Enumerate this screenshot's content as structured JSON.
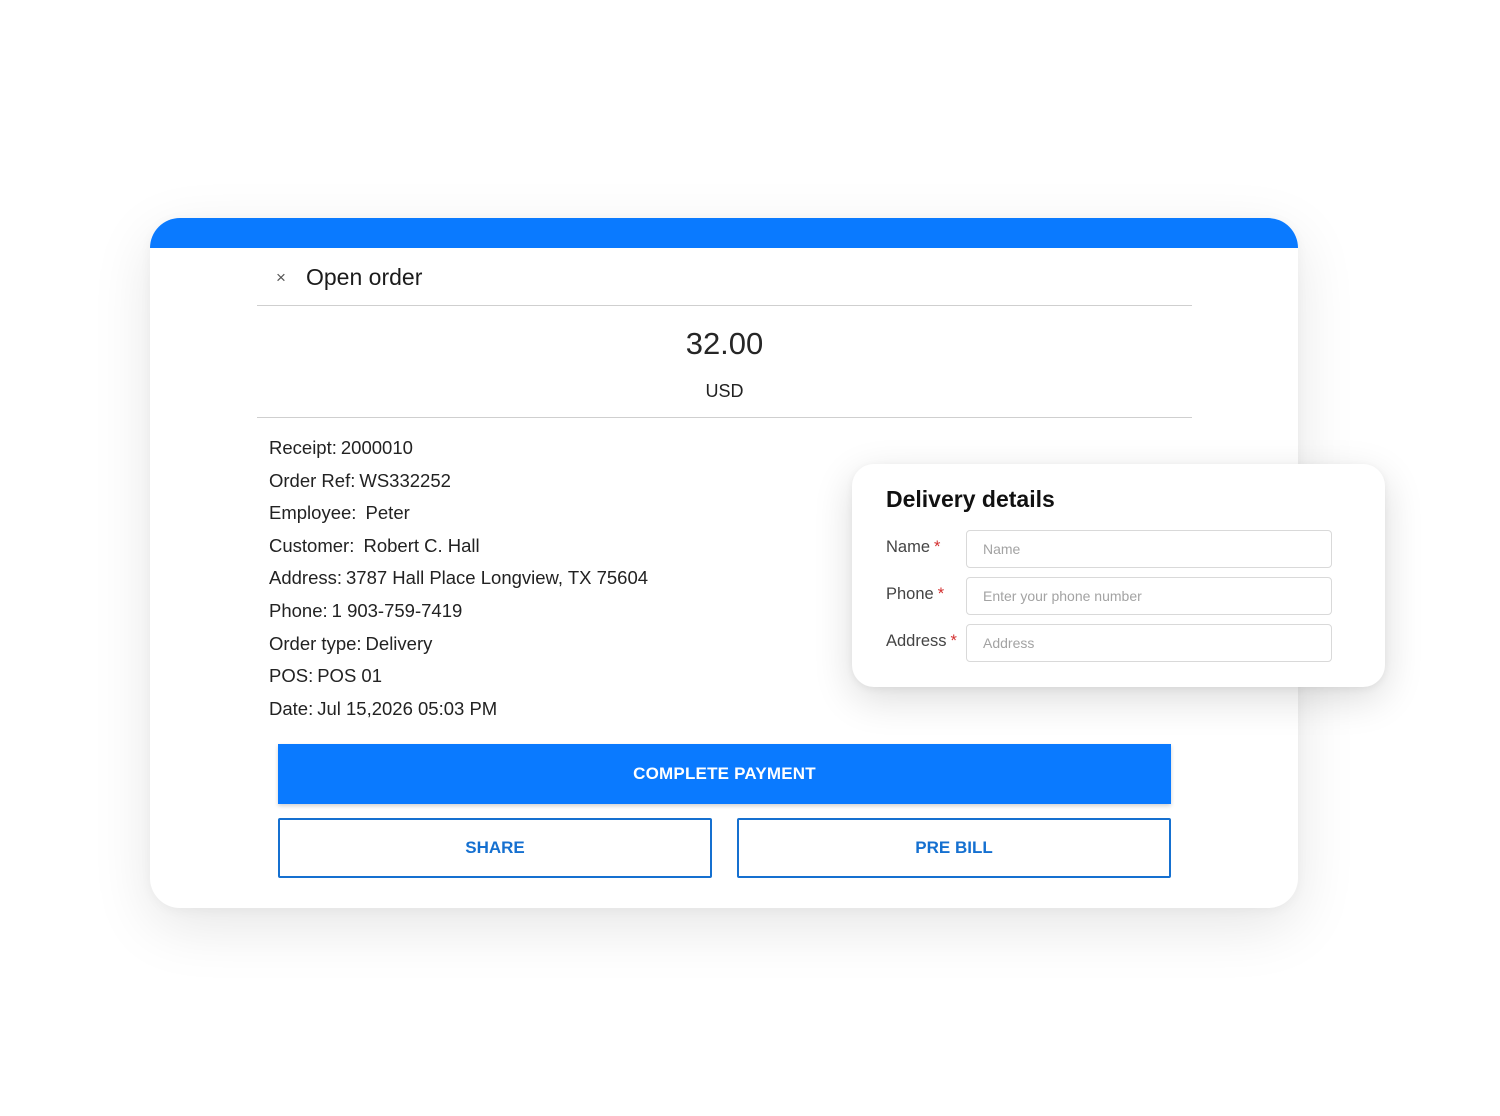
{
  "order": {
    "title": "Open order",
    "close_icon": "×",
    "amount": "32.00",
    "currency": "USD",
    "details": [
      {
        "label": "Receipt:",
        "value": "2000010"
      },
      {
        "label": "Order Ref:",
        "value": "WS332252"
      },
      {
        "label": "Employee:",
        "value": "Peter"
      },
      {
        "label": "Customer:",
        "value": "Robert C. Hall"
      },
      {
        "label": "Address:",
        "value": "3787 Hall Place Longview, TX 75604"
      },
      {
        "label": "Phone:",
        "value": "1 903-759-7419"
      },
      {
        "label": "Order type:",
        "value": "Delivery"
      },
      {
        "label": "POS:",
        "value": "POS 01"
      },
      {
        "label": "Date:",
        "value": "Jul 15,2026 05:03 PM"
      }
    ],
    "buttons": {
      "complete_payment": "COMPLETE PAYMENT",
      "share": "SHARE",
      "pre_bill": "PRE BILL"
    }
  },
  "delivery": {
    "title": "Delivery details",
    "required_mark": "*",
    "fields": {
      "name": {
        "label": "Name",
        "placeholder": "Name",
        "value": ""
      },
      "phone": {
        "label": "Phone",
        "placeholder": "Enter your phone number",
        "value": ""
      },
      "address": {
        "label": "Address",
        "placeholder": "Address",
        "value": ""
      }
    }
  },
  "colors": {
    "accent": "#0a7aff",
    "outline_button": "#1570d0",
    "required": "#d32f2f"
  }
}
